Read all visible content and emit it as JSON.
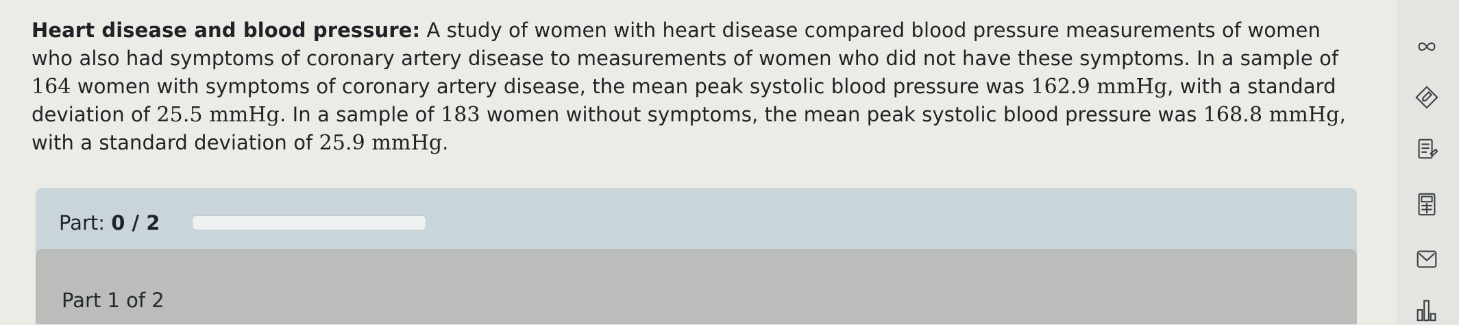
{
  "problem": {
    "title": "Heart disease and blood pressure:",
    "text_1": " A study of women with heart disease compared blood pressure measurements of women who also had symptoms of coronary artery disease to measurements of women who did not have these symptoms. In a sample of ",
    "n1": "164",
    "text_2": " women with symptoms of coronary artery disease, the mean peak systolic blood pressure was ",
    "mean1": "162.9 mmHg",
    "text_3": ", with a standard deviation of ",
    "sd1": "25.5 mmHg",
    "text_4": ". In a sample of ",
    "n2": "183",
    "text_5": " women without symptoms, the mean peak systolic blood pressure was ",
    "mean2": "168.8 mmHg",
    "text_6": ", with a standard deviation of ",
    "sd2": "25.9 mmHg",
    "text_7": "."
  },
  "progress": {
    "label": "Part: ",
    "value": "0 / 2",
    "fraction": 0
  },
  "part": {
    "label": "Part 1 of 2"
  },
  "sidebar": {
    "icons": [
      "infinity-icon",
      "pencil-icon",
      "worksheet-icon",
      "calculator-icon",
      "mail-icon",
      "bar-chart-icon"
    ]
  },
  "colors": {
    "progress_bg": "#c9d5db",
    "part_header_bg": "#bbbdba",
    "icon_stroke": "#3a4044"
  }
}
